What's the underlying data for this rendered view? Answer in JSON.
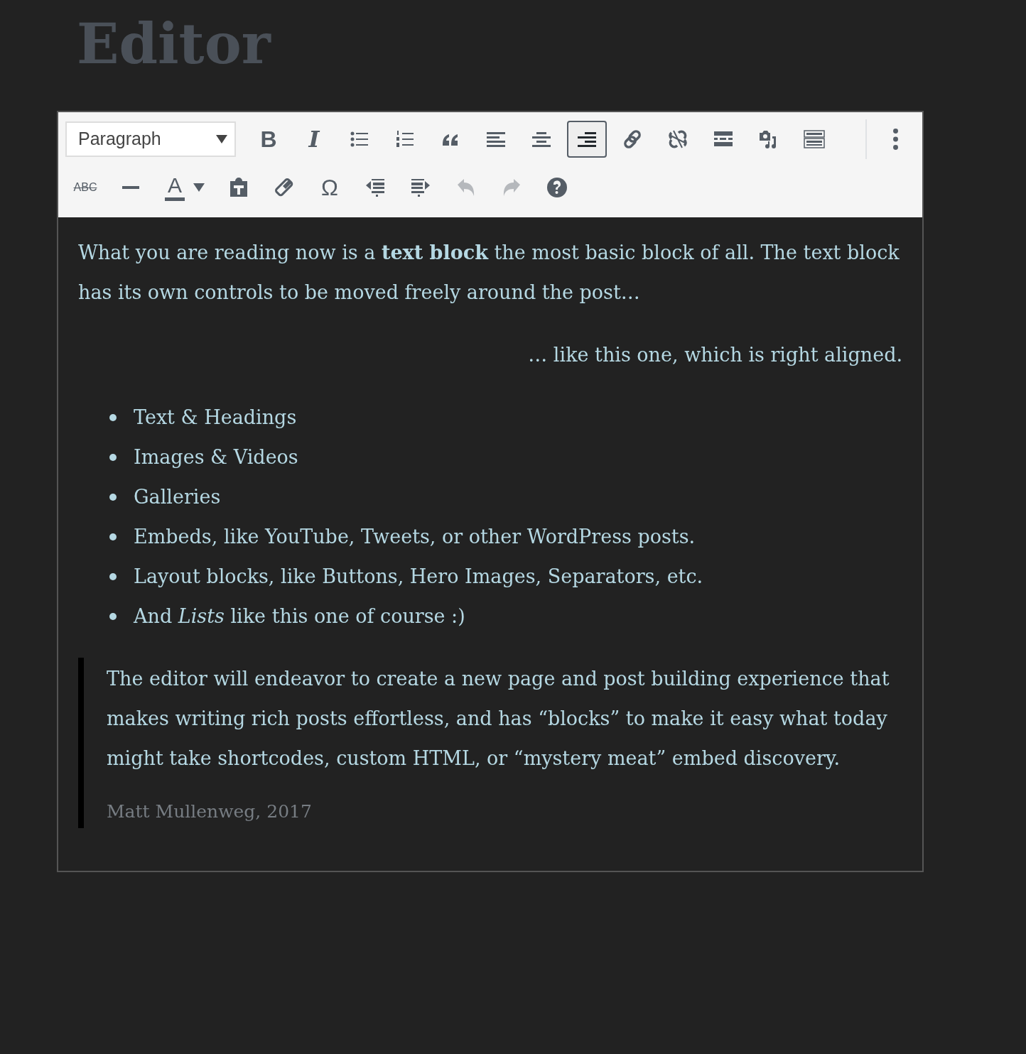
{
  "heading": "Editor",
  "toolbar": {
    "format_select": {
      "value": "Paragraph"
    },
    "row_1": [
      {
        "kind": "bold",
        "glyph": "B",
        "selected": false,
        "disabled": false
      },
      {
        "kind": "italic",
        "glyph": "I",
        "selected": false,
        "disabled": false
      },
      {
        "kind": "bullet-list",
        "selected": false,
        "disabled": false
      },
      {
        "kind": "numbered-list",
        "selected": false,
        "disabled": false
      },
      {
        "kind": "quote",
        "selected": false,
        "disabled": false
      },
      {
        "kind": "align-left",
        "selected": false,
        "disabled": false
      },
      {
        "kind": "align-center",
        "selected": false,
        "disabled": false
      },
      {
        "kind": "align-right",
        "selected": true,
        "disabled": false
      },
      {
        "kind": "link",
        "selected": false,
        "disabled": false
      },
      {
        "kind": "unlink",
        "selected": false,
        "disabled": false
      },
      {
        "kind": "read-more",
        "selected": false,
        "disabled": false
      },
      {
        "kind": "media",
        "selected": false,
        "disabled": false
      },
      {
        "kind": "keyboard",
        "selected": false,
        "disabled": false
      },
      {
        "kind": "more",
        "selected": false,
        "disabled": false
      }
    ],
    "row_2": [
      {
        "kind": "strikethrough",
        "glyph": "ABC",
        "selected": false,
        "disabled": false
      },
      {
        "kind": "horizontal-line",
        "selected": false,
        "disabled": false
      },
      {
        "kind": "text-color",
        "glyph": "A",
        "selected": false,
        "disabled": false
      },
      {
        "kind": "paste-text",
        "selected": false,
        "disabled": false
      },
      {
        "kind": "clear-formatting",
        "selected": false,
        "disabled": false
      },
      {
        "kind": "special-character",
        "glyph": "Ω",
        "selected": false,
        "disabled": false
      },
      {
        "kind": "outdent",
        "selected": false,
        "disabled": false
      },
      {
        "kind": "indent",
        "selected": false,
        "disabled": false
      },
      {
        "kind": "undo",
        "selected": false,
        "disabled": true
      },
      {
        "kind": "redo",
        "selected": false,
        "disabled": true
      },
      {
        "kind": "help",
        "selected": false,
        "disabled": false
      }
    ]
  },
  "content": [
    {
      "kind": "paragraph",
      "text": "What you are reading now is a **text block** the most basic block of all. The text block has its own controls to be moved freely around the post…"
    },
    {
      "kind": "right-aligned-paragraph",
      "text": "… like this one, which is right aligned."
    },
    {
      "kind": "list",
      "items": [
        "Text & Headings",
        "Images & Videos",
        "Galleries",
        "Embeds, like YouTube, Tweets, or other WordPress posts.",
        "Layout blocks, like Buttons, Hero Images, Separators, etc.",
        "And *Lists* like this one of course :)"
      ]
    },
    {
      "kind": "quote",
      "text": "The editor will endeavor to create a new page and post building experience that makes writing rich posts effortless, and has “blocks” to make it easy what today might take shortcodes, custom HTML, or “mystery meat” embed discovery.",
      "citation": "Matt Mullenweg, 2017"
    }
  ]
}
